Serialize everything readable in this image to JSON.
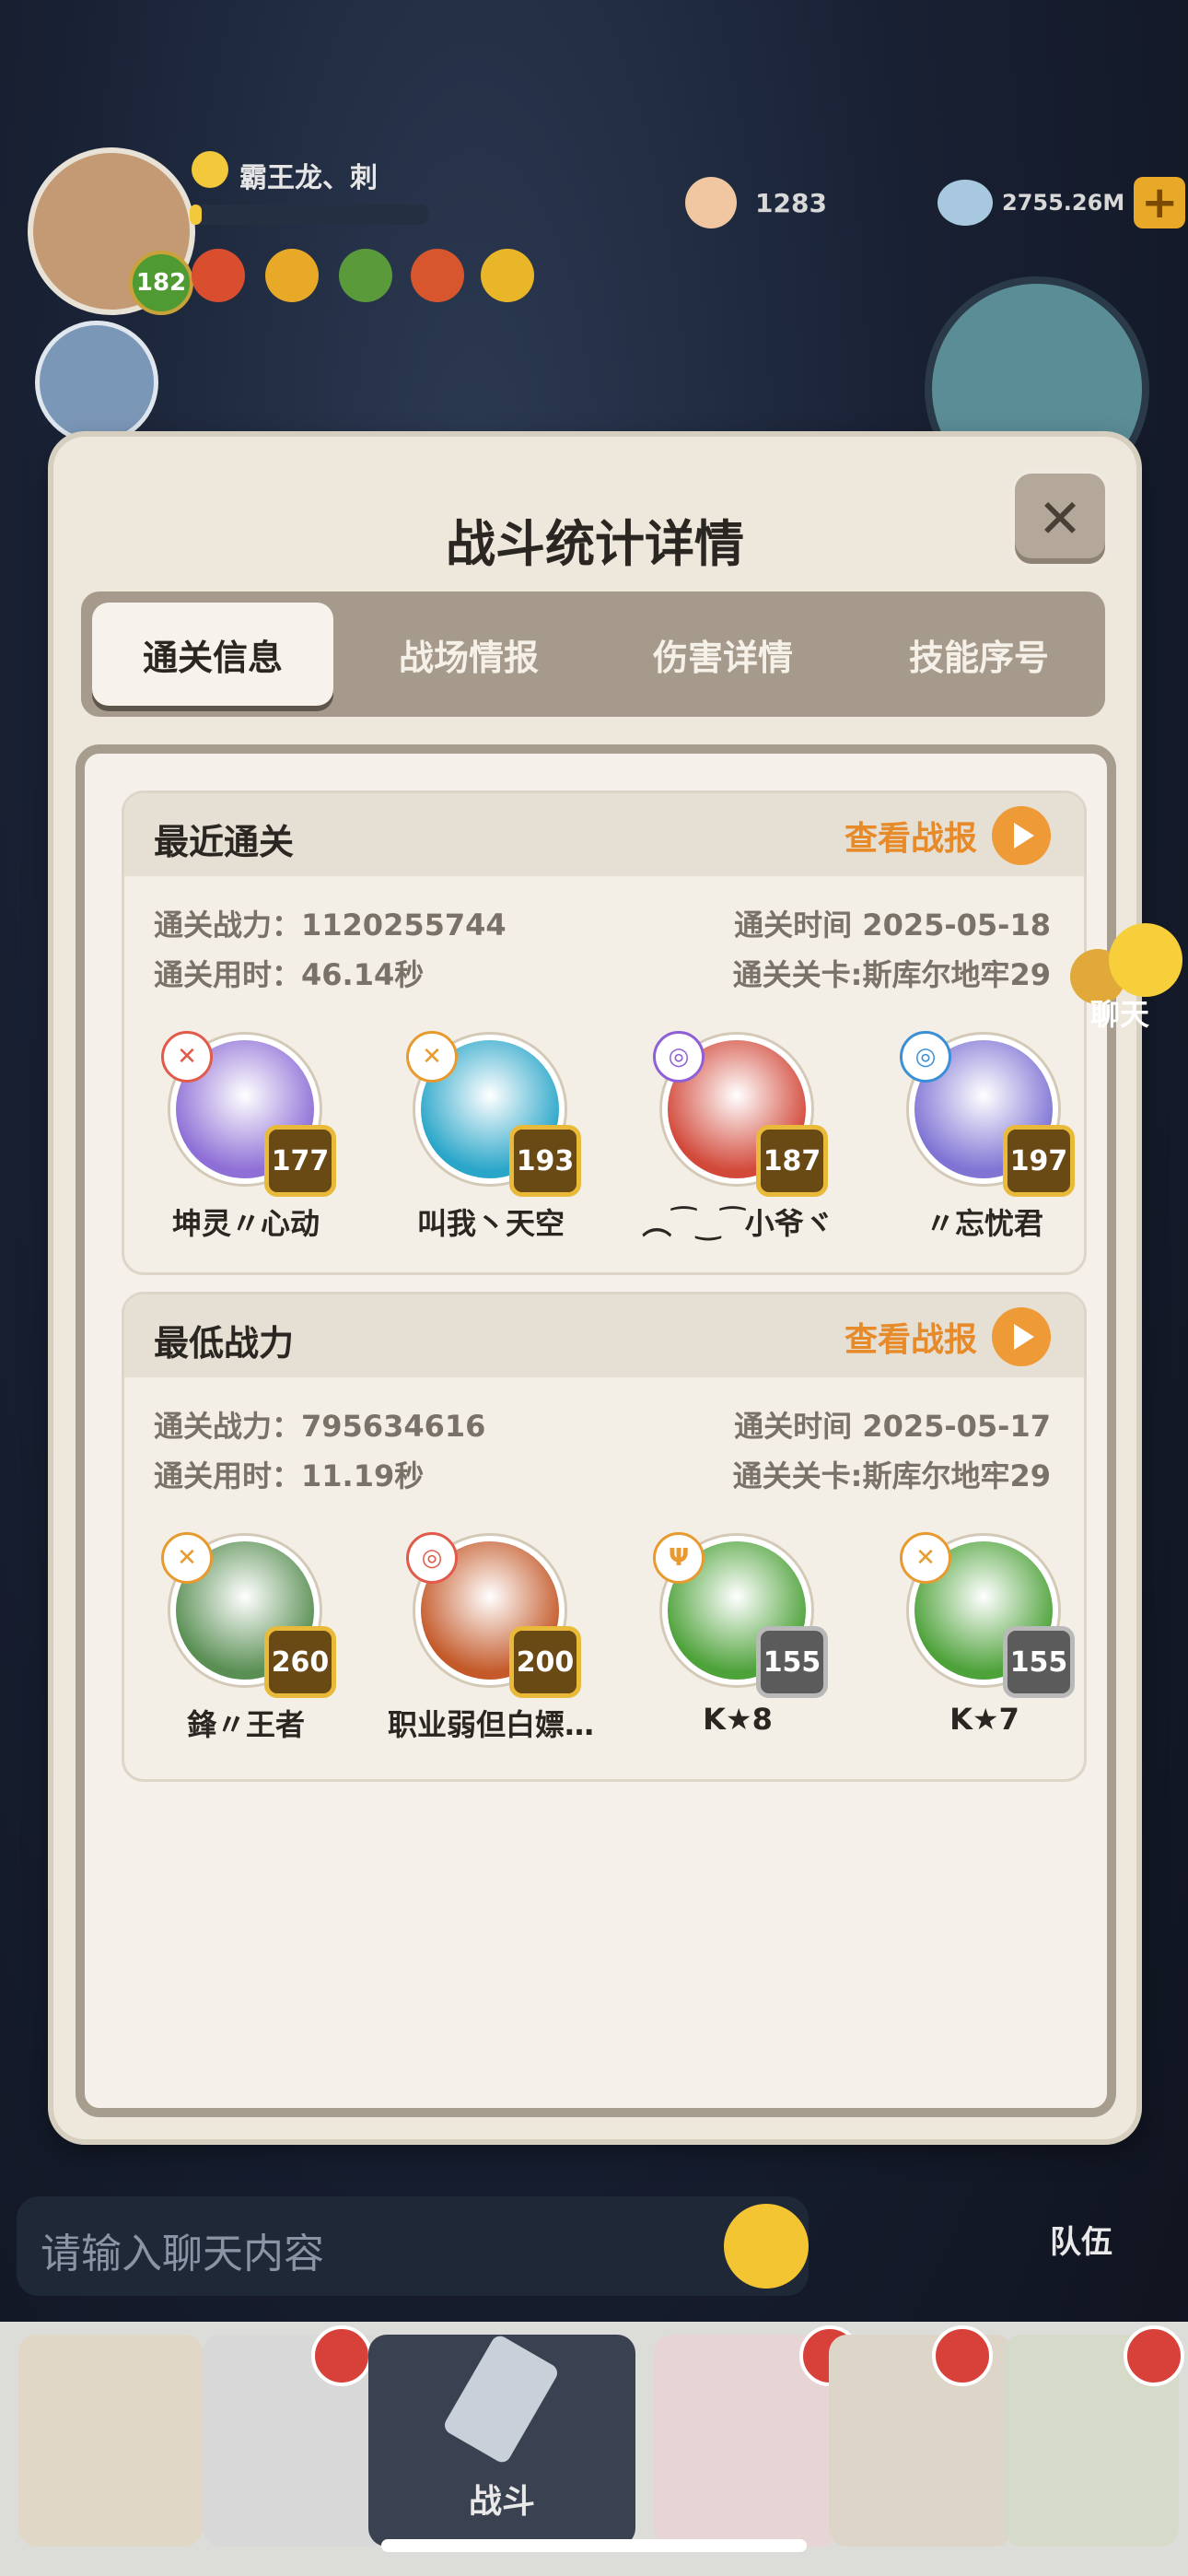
{
  "hud": {
    "player_name": "霸王龙、刺",
    "level": "182",
    "exp_fraction": 0.05,
    "coins": "1283",
    "gems": "2755.26M",
    "plus": "+"
  },
  "dialog": {
    "title": "战斗统计详情",
    "close": "✕",
    "tabs": [
      "通关信息",
      "战场情报",
      "伤害详情",
      "技能序号"
    ],
    "active_tab": 0
  },
  "recent": {
    "title": "最近通关",
    "view": "查看战报",
    "power": "通关战力：1120255744",
    "time_used": "通关用时：46.14秒",
    "date": "通关时间  2025-05-18",
    "stage": "通关关卡:斯库尔地牢29",
    "heroes": [
      {
        "name": "坤灵〃心动",
        "level": "177",
        "color": "#8e6fd6"
      },
      {
        "name": "叫我丶天空",
        "level": "193",
        "color": "#2aa6c9"
      },
      {
        "name": "︵⁀‿⁀小爷ヾ",
        "level": "187",
        "color": "#d2493a"
      },
      {
        "name": "〃忘忧君",
        "level": "197",
        "color": "#7f74d4"
      }
    ]
  },
  "lowest": {
    "title": "最低战力",
    "view": "查看战报",
    "power": "通关战力：795634616",
    "time_used": "通关用时：11.19秒",
    "date": "通关时间  2025-05-17",
    "stage": "通关关卡:斯库尔地牢29",
    "heroes": [
      {
        "name": "鋒〃王者",
        "level": "260",
        "color": "#5a8f54"
      },
      {
        "name": "职业弱但白嫖…",
        "level": "200",
        "color": "#c45a2a"
      },
      {
        "name": "K★8",
        "level": "155",
        "color": "#4ea23a"
      },
      {
        "name": "K★7",
        "level": "155",
        "color": "#4ea23a"
      }
    ]
  },
  "chat": {
    "label": "聊天",
    "placeholder": "请输入聊天内容",
    "team": "队伍"
  },
  "nav": {
    "battle": "战斗"
  }
}
